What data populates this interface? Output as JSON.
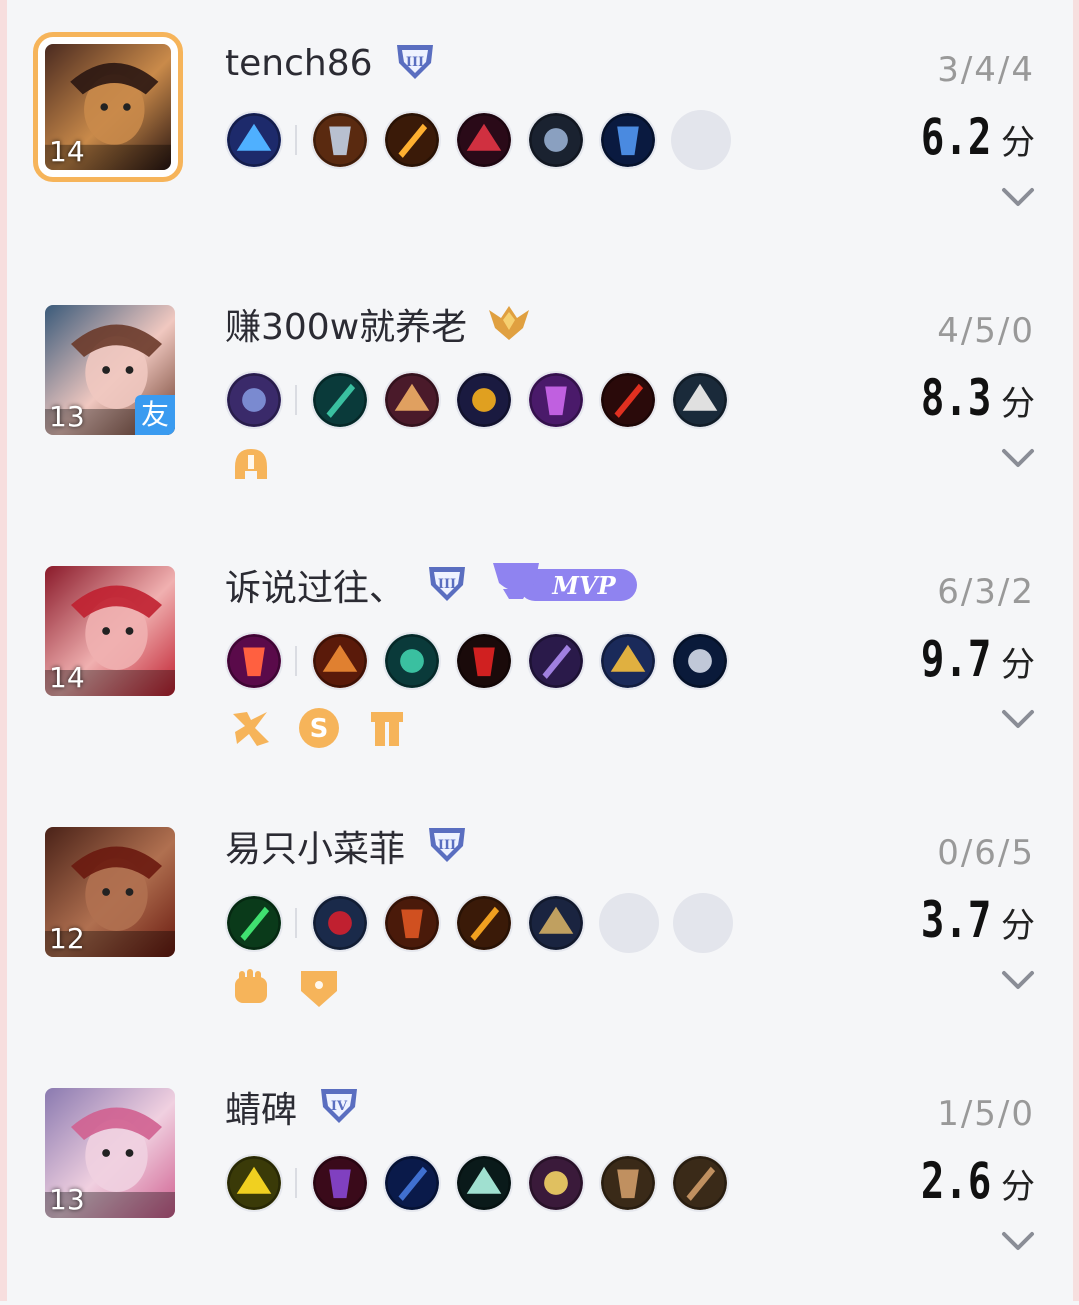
{
  "players": [
    {
      "name": "tench86",
      "level": "14",
      "rank_icon": "rank-iii-shield-icon",
      "kda": "3/4/4",
      "score": "6.2",
      "score_unit": "分",
      "is_self": true,
      "is_friend": false,
      "mvp": false,
      "mvp_label": "",
      "avatar_colors": [
        "#4a2a20",
        "#c98a4a",
        "#2a1612"
      ],
      "items": [
        {
          "icon": "lightning-spell-icon",
          "c": [
            "#1d2a6b",
            "#4fb0ff"
          ]
        },
        {
          "sep": true
        },
        {
          "icon": "boots-icon",
          "c": [
            "#5a2a10",
            "#b8c0d0"
          ]
        },
        {
          "icon": "lightning-sword-icon",
          "c": [
            "#3a1a08",
            "#ffb030"
          ]
        },
        {
          "icon": "dark-blade-icon",
          "c": [
            "#2a0a18",
            "#d03040"
          ]
        },
        {
          "icon": "armor-icon",
          "c": [
            "#1a2230",
            "#8aa0c0"
          ]
        },
        {
          "icon": "bow-icon",
          "c": [
            "#0a1a40",
            "#4a8ae0"
          ]
        },
        {
          "empty": true
        }
      ],
      "badges": []
    },
    {
      "name": "赚300w就养老",
      "level": "13",
      "rank_icon": "rank-gold-wings-icon",
      "kda": "4/5/0",
      "score": "8.3",
      "score_unit": "分",
      "is_self": false,
      "is_friend": true,
      "friend_label": "友",
      "mvp": false,
      "mvp_label": "",
      "avatar_colors": [
        "#3a5a7a",
        "#f0c8c0",
        "#6a3a2a"
      ],
      "items": [
        {
          "icon": "gargoyle-spell-icon",
          "c": [
            "#3a2a6a",
            "#7a8ad0"
          ]
        },
        {
          "sep": true
        },
        {
          "icon": "green-boots-icon",
          "c": [
            "#0a3a3a",
            "#3ac0a0"
          ]
        },
        {
          "icon": "mask-icon",
          "c": [
            "#4a1a2a",
            "#e0a060"
          ]
        },
        {
          "icon": "chalice-icon",
          "c": [
            "#1a1a40",
            "#e0a020"
          ]
        },
        {
          "icon": "purple-cloak-icon",
          "c": [
            "#4a1a6a",
            "#c060e0"
          ]
        },
        {
          "icon": "red-gem-icon",
          "c": [
            "#2a0a0a",
            "#e03020"
          ]
        },
        {
          "icon": "white-armor-icon",
          "c": [
            "#1a2a3a",
            "#e0e0e0"
          ]
        }
      ],
      "badges": [
        "orange-helmet-badge-icon"
      ]
    },
    {
      "name": "诉说过往、",
      "level": "14",
      "rank_icon": "rank-iii-shield-icon",
      "kda": "6/3/2",
      "score": "9.7",
      "score_unit": "分",
      "is_self": false,
      "is_friend": false,
      "mvp": true,
      "mvp_label": "MVP",
      "avatar_colors": [
        "#8a1a2a",
        "#f0b0b0",
        "#c02030"
      ],
      "items": [
        {
          "icon": "slash-spell-icon",
          "c": [
            "#5a0a4a",
            "#ff6040"
          ]
        },
        {
          "sep": true
        },
        {
          "icon": "golden-axe-icon",
          "c": [
            "#5a1a0a",
            "#e08030"
          ]
        },
        {
          "icon": "green-boots-icon",
          "c": [
            "#0a3a3a",
            "#3ac0a0"
          ]
        },
        {
          "icon": "red-scythe-icon",
          "c": [
            "#1a0a0a",
            "#d02020"
          ]
        },
        {
          "icon": "purple-claw-icon",
          "c": [
            "#2a1a4a",
            "#a080e0"
          ]
        },
        {
          "icon": "sun-blade-icon",
          "c": [
            "#1a2a5a",
            "#e0b040"
          ]
        },
        {
          "icon": "steel-sword-icon",
          "c": [
            "#0a1a3a",
            "#c0c8d8"
          ]
        }
      ],
      "badges": [
        "orange-kill-badge-icon",
        "orange-s-badge-icon",
        "orange-tower-badge-icon"
      ]
    },
    {
      "name": "易只小菜菲",
      "level": "12",
      "rank_icon": "rank-iii-shield-icon",
      "kda": "0/6/5",
      "score": "3.7",
      "score_unit": "分",
      "is_self": false,
      "is_friend": false,
      "mvp": false,
      "mvp_label": "",
      "avatar_colors": [
        "#4a2218",
        "#b07050",
        "#6a1a10"
      ],
      "items": [
        {
          "icon": "green-dash-spell-icon",
          "c": [
            "#0a3a1a",
            "#40e070"
          ]
        },
        {
          "sep": true
        },
        {
          "icon": "red-boots-icon",
          "c": [
            "#1a2a4a",
            "#c02030"
          ]
        },
        {
          "icon": "red-chestplate-icon",
          "c": [
            "#4a1a0a",
            "#d05020"
          ]
        },
        {
          "icon": "gold-helm-icon",
          "c": [
            "#3a1a08",
            "#f0a020"
          ]
        },
        {
          "icon": "gold-armor-icon",
          "c": [
            "#1a2440",
            "#c0a060"
          ]
        },
        {
          "empty": true
        },
        {
          "empty": true
        }
      ],
      "badges": [
        "orange-fist-badge-icon",
        "orange-shield-badge-icon"
      ]
    },
    {
      "name": "蜻碑",
      "level": "13",
      "rank_icon": "rank-iv-shield-icon",
      "kda": "1/5/0",
      "score": "2.6",
      "score_unit": "分",
      "is_self": false,
      "is_friend": false,
      "mvp": false,
      "mvp_label": "",
      "avatar_colors": [
        "#8a7ab0",
        "#f0d0e0",
        "#d06090"
      ],
      "items": [
        {
          "icon": "yellow-spin-spell-icon",
          "c": [
            "#3a3a08",
            "#f0d020"
          ]
        },
        {
          "sep": true
        },
        {
          "icon": "dark-hat-icon",
          "c": [
            "#3a0a1a",
            "#8040c0"
          ]
        },
        {
          "icon": "blue-boots-icon",
          "c": [
            "#0a1a4a",
            "#4070d0"
          ]
        },
        {
          "icon": "feather-icon",
          "c": [
            "#0a1a1a",
            "#a0e0d0"
          ]
        },
        {
          "icon": "spellbook-icon",
          "c": [
            "#3a1a3a",
            "#e0c060"
          ]
        },
        {
          "icon": "wooden-crate-icon",
          "c": [
            "#3a2a18",
            "#c09060"
          ]
        },
        {
          "icon": "wooden-crate-icon",
          "c": [
            "#3a2a18",
            "#c09060"
          ]
        }
      ],
      "badges": []
    }
  ],
  "colors": {
    "self_border": "#f6b45a",
    "friend_bg": "#3a9bf0",
    "badge_orange": "#f6b45a",
    "mvp_purple": "#8f83f0",
    "rank_blue": "#5a6ec0"
  }
}
